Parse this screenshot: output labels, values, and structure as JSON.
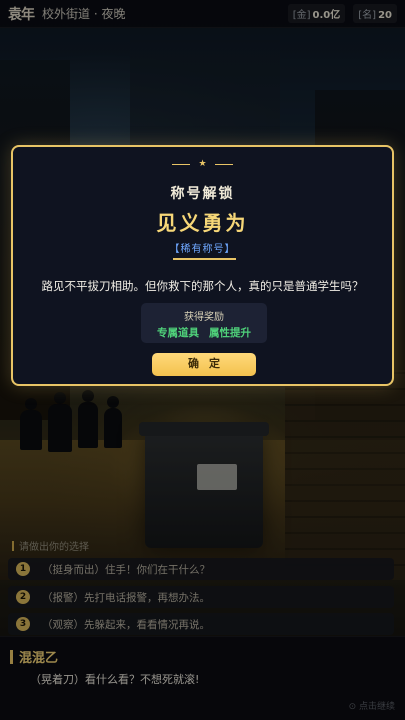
{
  "header": {
    "logo": "袁年",
    "location": "校外街道 · 夜晚",
    "stats": [
      {
        "label": "[金]",
        "value": "0.0亿"
      },
      {
        "label": "[名]",
        "value": "20"
      }
    ]
  },
  "modal": {
    "title": "称号解锁",
    "title_name": "见义勇为",
    "rarity": "【稀有称号】",
    "description": "路见不平拔刀相助。但你救下的那个人，真的只是普通学生吗？",
    "reward_title": "获得奖励",
    "rewards": [
      "专属道具",
      "属性提升"
    ],
    "confirm_label": "确定",
    "accent_color": "#e8c466"
  },
  "choices": {
    "prompt": "请做出你的选择",
    "options": [
      {
        "num": "1",
        "text": "（挺身而出）住手！你们在干什么？"
      },
      {
        "num": "2",
        "text": "（报警）先打电话报警，再想办法。"
      },
      {
        "num": "3",
        "text": "（观察）先躲起来，看看情况再说。"
      }
    ]
  },
  "dialogue": {
    "speaker": "混混乙",
    "line": "（晃着刀）看什么看？不想死就滚!",
    "autoplay": "⊙ 点击继续"
  }
}
